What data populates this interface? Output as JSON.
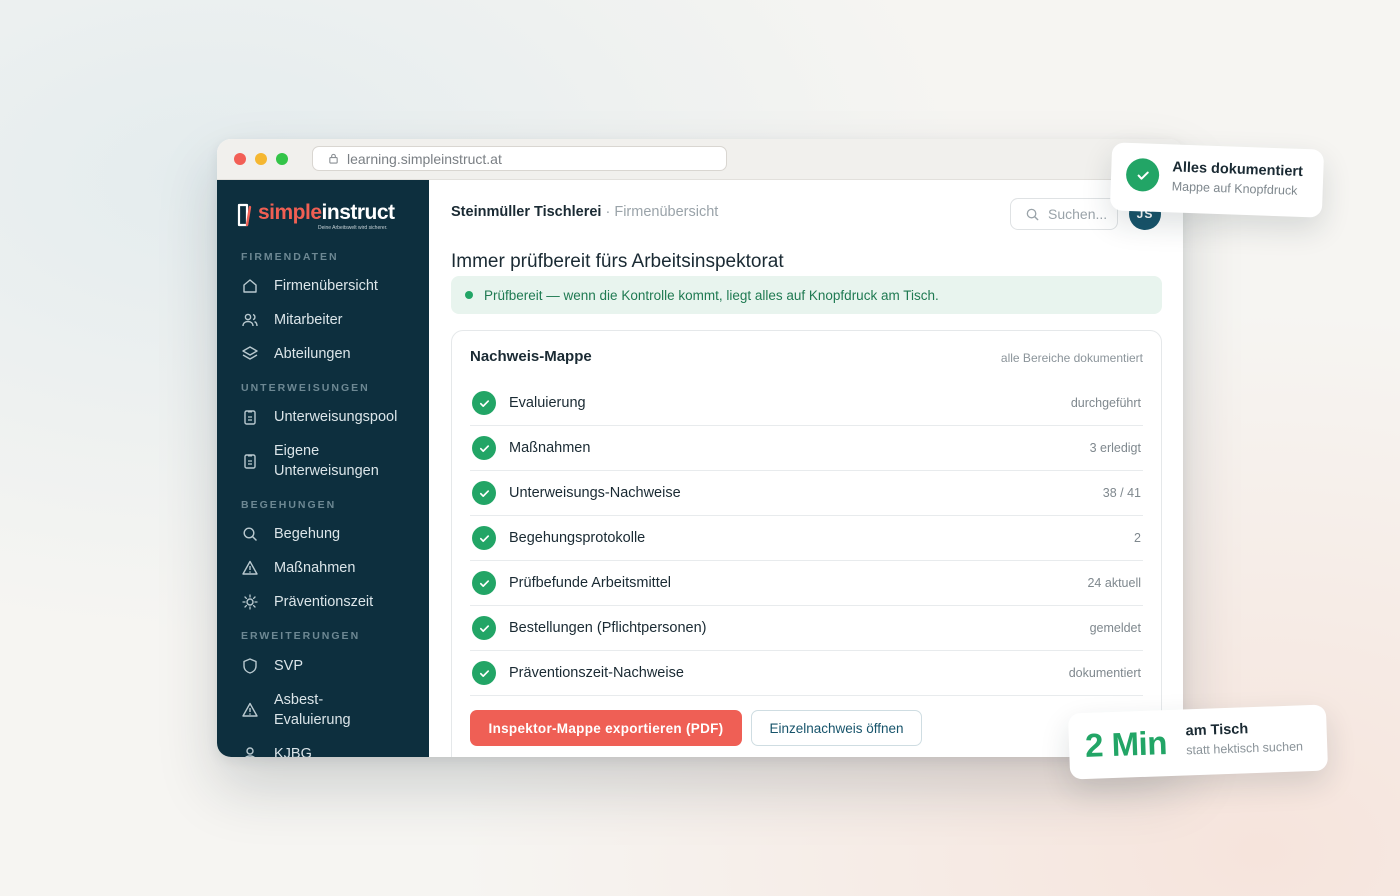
{
  "browser": {
    "url": "learning.simpleinstruct.at"
  },
  "logo": {
    "brand_part1": "simple",
    "brand_part2": "instruct",
    "tagline": "Deine Arbeitswelt wird sicherer."
  },
  "sidebar": {
    "sections": [
      {
        "label": "FIRMENDATEN",
        "items": [
          {
            "label": "Firmenübersicht",
            "icon": "home-icon"
          },
          {
            "label": "Mitarbeiter",
            "icon": "users-icon"
          },
          {
            "label": "Abteilungen",
            "icon": "layers-icon"
          }
        ]
      },
      {
        "label": "UNTERWEISUNGEN",
        "items": [
          {
            "label": "Unterweisungspool",
            "icon": "clipboard-icon"
          },
          {
            "label": "Eigene Unterweisungen",
            "icon": "clipboard-icon"
          }
        ]
      },
      {
        "label": "BEGEHUNGEN",
        "items": [
          {
            "label": "Begehung",
            "icon": "search-icon"
          },
          {
            "label": "Maßnahmen",
            "icon": "warning-icon"
          },
          {
            "label": "Präventionszeit",
            "icon": "sun-icon"
          }
        ]
      },
      {
        "label": "ERWEITERUNGEN",
        "items": [
          {
            "label": "SVP",
            "icon": "shield-icon"
          },
          {
            "label": "Asbest-Evaluierung",
            "icon": "warning-icon"
          },
          {
            "label": "KJBG",
            "icon": "user-icon"
          }
        ]
      }
    ]
  },
  "header": {
    "company": "Steinmüller Tischlerei",
    "separator": "·",
    "page": "Firmenübersicht",
    "search_placeholder": "Suchen...",
    "avatar_initials": "JS"
  },
  "main": {
    "headline": "Immer prüfbereit fürs Arbeitsinspektorat",
    "banner": "Prüfbereit — wenn die Kontrolle kommt, liegt alles auf Knopfdruck am Tisch."
  },
  "card": {
    "title": "Nachweis-Mappe",
    "meta": "alle Bereiche dokumentiert",
    "rows": [
      {
        "label": "Evaluierung",
        "value": "durchgeführt"
      },
      {
        "label": "Maßnahmen",
        "value": "3 erledigt"
      },
      {
        "label": "Unterweisungs-Nachweise",
        "value": "38 / 41"
      },
      {
        "label": "Begehungsprotokolle",
        "value": "2"
      },
      {
        "label": "Prüfbefunde Arbeitsmittel",
        "value": "24 aktuell"
      },
      {
        "label": "Bestellungen (Pflichtpersonen)",
        "value": "gemeldet"
      },
      {
        "label": "Präventionszeit-Nachweise",
        "value": "dokumentiert"
      }
    ],
    "export_button": "Inspektor-Mappe exportieren (PDF)",
    "open_button": "Einzelnachweis öffnen"
  },
  "float_documented": {
    "title": "Alles dokumentiert",
    "subtitle": "Mappe auf Knopfdruck"
  },
  "float_time": {
    "big": "2 Min",
    "title": "am Tisch",
    "subtitle": "statt hektisch suchen"
  },
  "colors": {
    "accent": "#ef5f55",
    "sidebar": "#0d2f3e",
    "success": "#22a566"
  }
}
